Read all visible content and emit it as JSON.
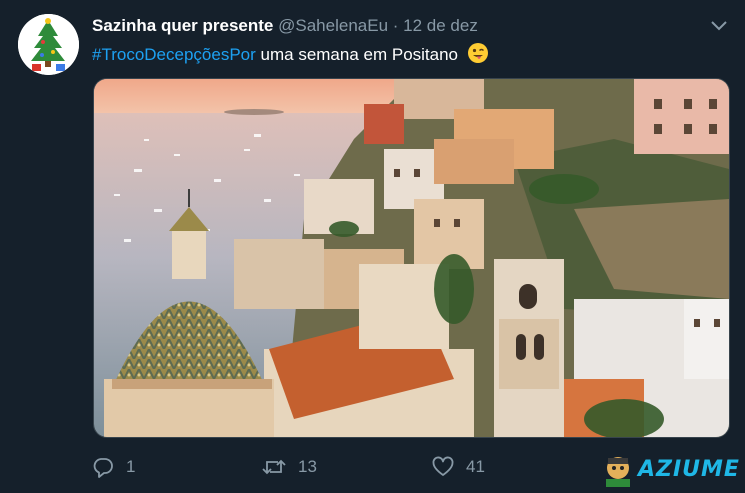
{
  "tweet": {
    "display_name": "Sazinha quer presente",
    "handle": "@SahelenaEu",
    "separator": "·",
    "date": "12 de dez",
    "hashtag": "#TrocoDecepçõesPor",
    "text": " uma semana em Positano",
    "emoji": "winking-face-tongue"
  },
  "actions": {
    "reply_count": "1",
    "retweet_count": "13",
    "like_count": "41"
  },
  "watermark": {
    "text": "AZIUME"
  },
  "colors": {
    "background": "#15202b",
    "accent": "#1da1f2",
    "muted": "#8899a6"
  },
  "icons": [
    "christmas-tree-avatar",
    "chevron-down-icon",
    "reply-icon",
    "retweet-icon",
    "like-icon"
  ]
}
